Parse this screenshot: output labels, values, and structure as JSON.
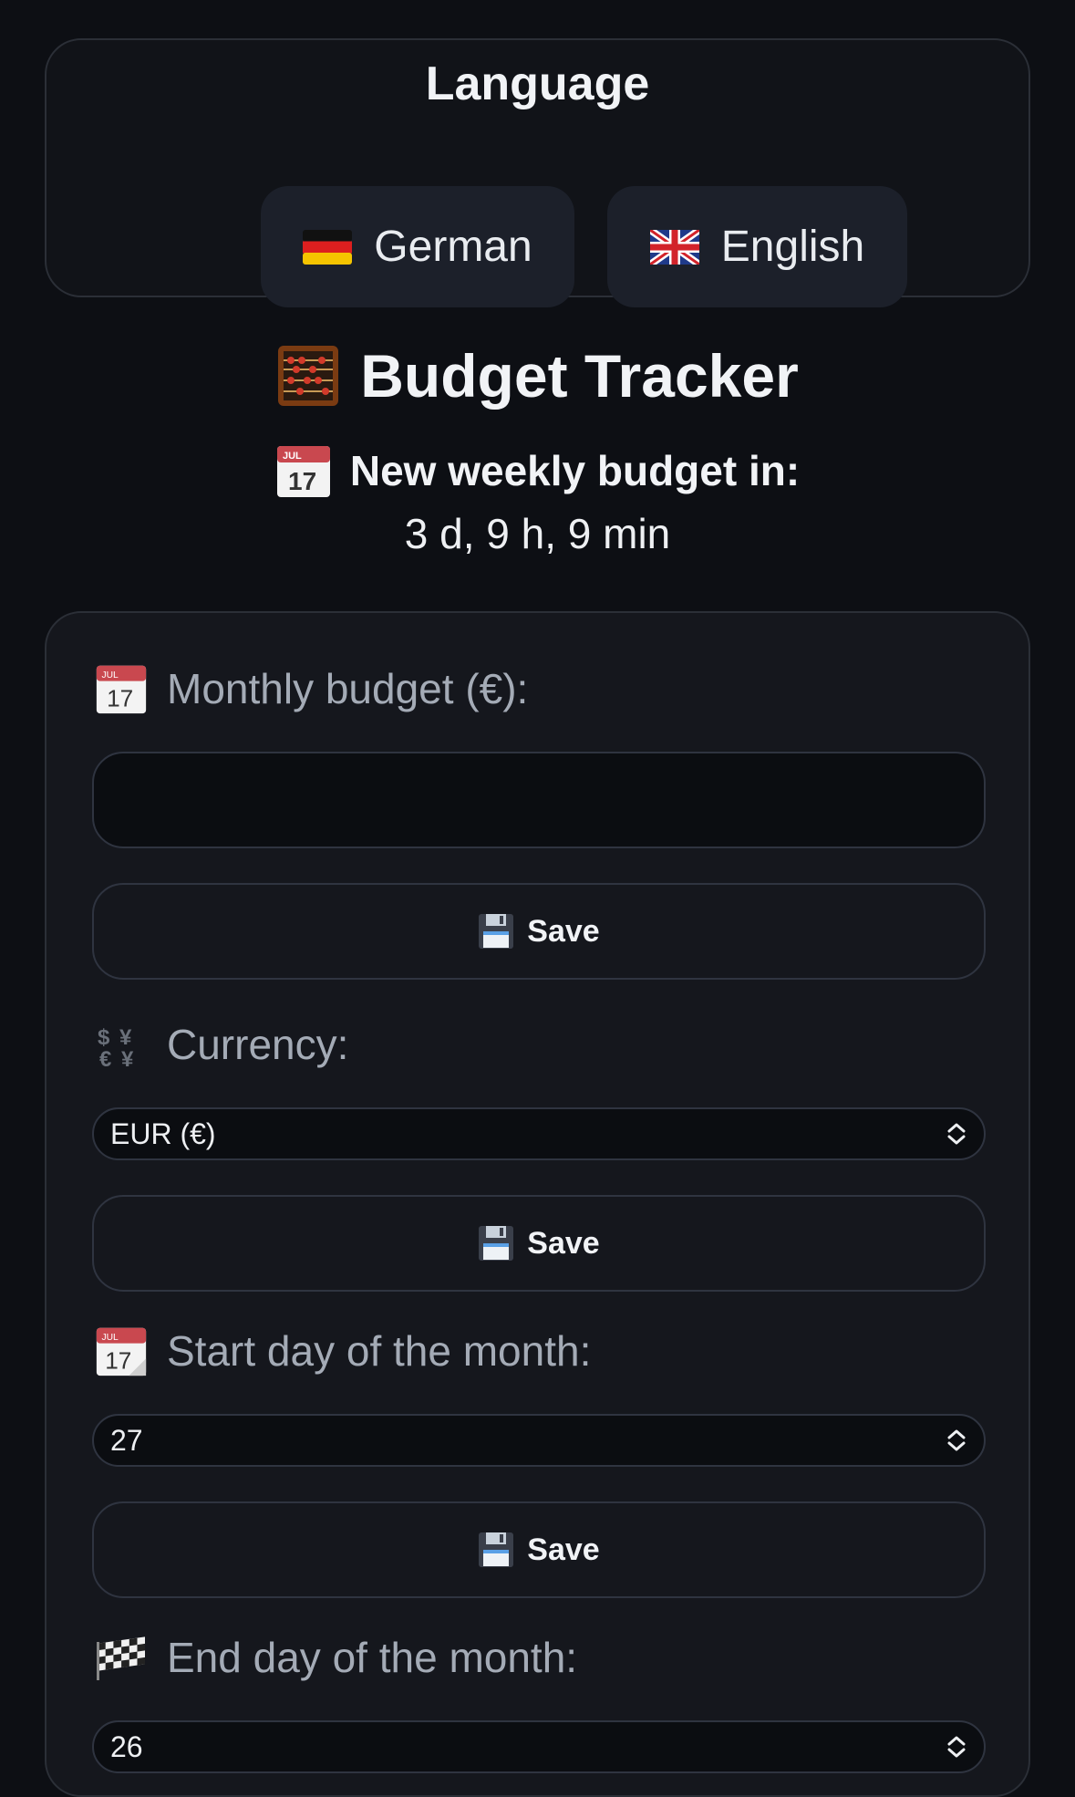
{
  "language_section": {
    "title": "Language",
    "buttons": [
      {
        "flag": "germany-flag-icon",
        "label": "German"
      },
      {
        "flag": "uk-flag-icon",
        "label": "English"
      }
    ]
  },
  "header": {
    "title": "Budget Tracker",
    "title_icon": "abacus-icon",
    "weekly_label": "New weekly budget in:",
    "weekly_icon": "calendar-icon",
    "countdown": "3 d, 9 h, 9 min"
  },
  "settings": {
    "monthly_budget": {
      "icon": "calendar-icon",
      "label": "Monthly budget (€):",
      "value": "",
      "save_label": "Save"
    },
    "currency": {
      "icon": "currency-exchange-icon",
      "label": "Currency:",
      "selected": "EUR (€)",
      "save_label": "Save"
    },
    "start_day": {
      "icon": "tear-off-calendar-icon",
      "label": "Start day of the month:",
      "selected": "27",
      "save_label": "Save"
    },
    "end_day": {
      "icon": "checkered-flag-icon",
      "label": "End day of the month:",
      "selected": "26"
    }
  },
  "colors": {
    "background": "#0d0f14",
    "card": "#15171d",
    "border": "#2f3440",
    "button": "#1c202a",
    "label": "#a4abb6",
    "text": "#f1f3f6"
  }
}
